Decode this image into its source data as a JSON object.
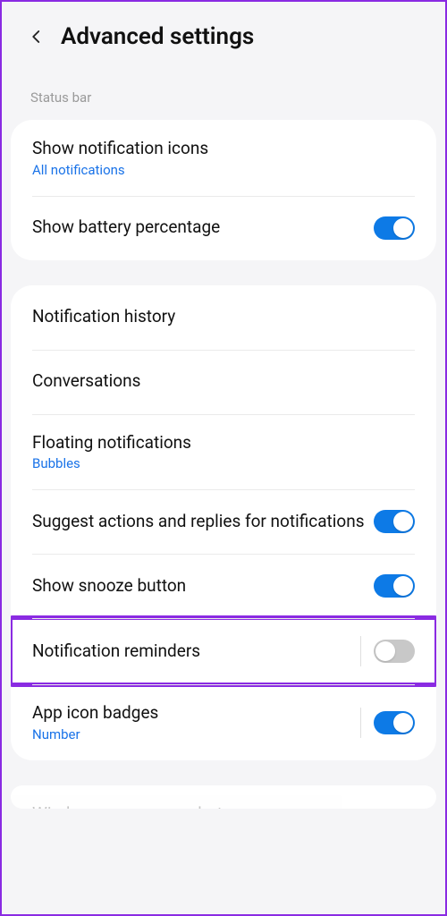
{
  "header": {
    "title": "Advanced settings"
  },
  "section1": {
    "label": "Status bar",
    "item0": {
      "title": "Show notification icons",
      "sub": "All notifications"
    },
    "item1": {
      "title": "Show battery percentage",
      "toggle": true
    }
  },
  "section2": {
    "item0": {
      "title": "Notification history"
    },
    "item1": {
      "title": "Conversations"
    },
    "item2": {
      "title": "Floating notifications",
      "sub": "Bubbles"
    },
    "item3": {
      "title": "Suggest actions and replies for notifications",
      "toggle": true
    },
    "item4": {
      "title": "Show snooze button",
      "toggle": true
    },
    "item5": {
      "title": "Notification reminders",
      "toggle": false
    },
    "item6": {
      "title": "App icon badges",
      "sub": "Number",
      "toggle": true
    }
  },
  "section3": {
    "item0": {
      "title": "Wireless emergency alerts"
    }
  }
}
